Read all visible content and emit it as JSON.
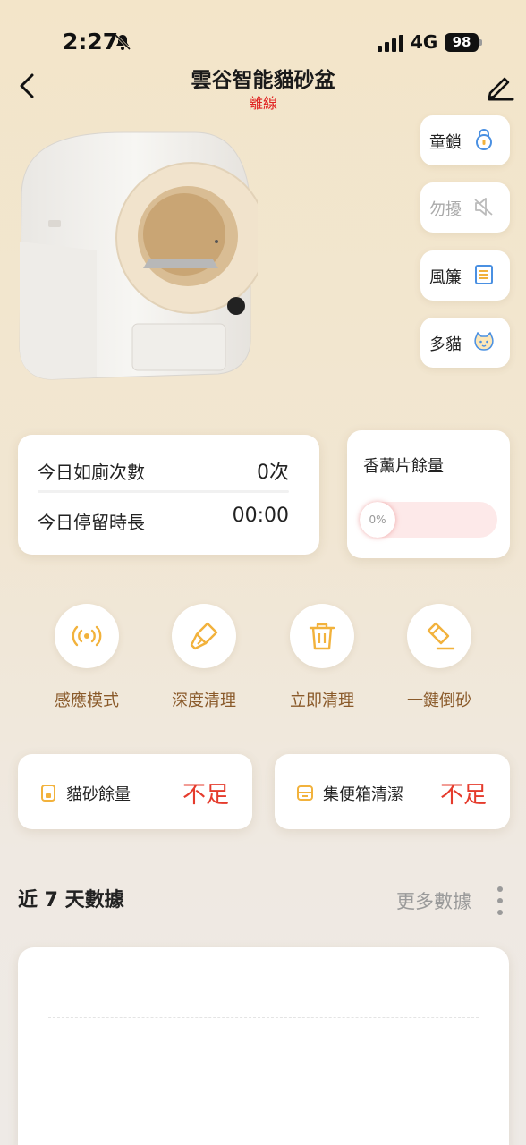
{
  "status_bar": {
    "time": "2:27",
    "network": "4G",
    "battery": "98"
  },
  "header": {
    "title": "雲谷智能貓砂盆",
    "status": "離線"
  },
  "side_buttons": [
    {
      "label": "童鎖",
      "icon": "lock-icon",
      "enabled": true
    },
    {
      "label": "勿擾",
      "icon": "mute-icon",
      "enabled": false
    },
    {
      "label": "風簾",
      "icon": "curtain-icon",
      "enabled": true
    },
    {
      "label": "多貓",
      "icon": "cat-icon",
      "enabled": true
    }
  ],
  "stats": {
    "visits_label": "今日如廁次數",
    "visits_value": "0次",
    "duration_label": "今日停留時長",
    "duration_value": "00:00"
  },
  "aroma": {
    "title": "香薰片餘量",
    "percent_label": "0%",
    "level": 0
  },
  "actions": [
    {
      "label": "感應模式",
      "icon": "sensor-icon"
    },
    {
      "label": "深度清理",
      "icon": "brush-icon"
    },
    {
      "label": "立即清理",
      "icon": "trash-icon"
    },
    {
      "label": "一鍵倒砂",
      "icon": "eraser-icon"
    }
  ],
  "status_cards": [
    {
      "label": "貓砂餘量",
      "value": "不足",
      "icon": "litter-icon"
    },
    {
      "label": "集便箱清潔",
      "value": "不足",
      "icon": "bin-icon"
    }
  ],
  "section": {
    "title": "近 7 天數據",
    "more_label": "更多數據"
  },
  "colors": {
    "accent": "#f2b23c",
    "warning": "#e53b2c",
    "offline": "#e02020",
    "action_label": "#8a5a2a"
  }
}
